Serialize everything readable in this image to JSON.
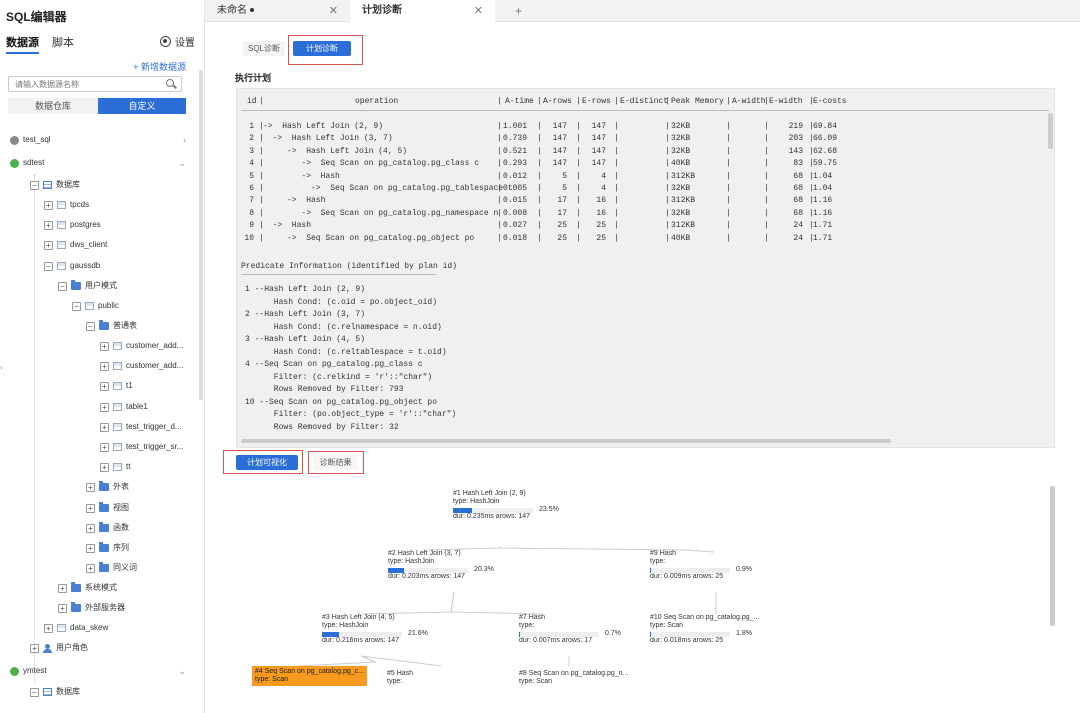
{
  "app_title": "SQL编辑器",
  "sidebar": {
    "tabs": [
      "数据源",
      "脚本"
    ],
    "settings_label": "设置",
    "add_datasource": "+ 新增数据源",
    "search_placeholder": "请输入数据源名称",
    "segments": [
      "数据仓库",
      "自定义"
    ],
    "tree": [
      {
        "label": "test_sql",
        "icon": "database-gray-icon"
      },
      {
        "label": "sdtest",
        "icon": "database-icon"
      },
      {
        "label": "数据库"
      },
      {
        "label": "tpcds"
      },
      {
        "label": "postgres"
      },
      {
        "label": "dws_client"
      },
      {
        "label": "gaussdb"
      },
      {
        "label": "用户模式"
      },
      {
        "label": "public"
      },
      {
        "label": "普通表"
      },
      {
        "label": "customer_add..."
      },
      {
        "label": "customer_add..."
      },
      {
        "label": "t1"
      },
      {
        "label": "table1"
      },
      {
        "label": "test_trigger_d..."
      },
      {
        "label": "test_trigger_sr..."
      },
      {
        "label": "tt"
      },
      {
        "label": "外表"
      },
      {
        "label": "视图"
      },
      {
        "label": "函数"
      },
      {
        "label": "序列"
      },
      {
        "label": "同义词"
      },
      {
        "label": "系统模式"
      },
      {
        "label": "外部服务器"
      },
      {
        "label": "data_skew"
      },
      {
        "label": "用户角色"
      },
      {
        "label": "ymtest",
        "icon": "database-icon"
      },
      {
        "label": "数据库"
      }
    ]
  },
  "tabs": [
    {
      "label": "未命名",
      "modified": true
    },
    {
      "label": "计划诊断",
      "active": true
    }
  ],
  "subtabs": [
    "SQL诊断",
    "计划诊断"
  ],
  "plan_title": "执行计划",
  "plan": {
    "headers": [
      "id",
      "operation",
      "A-time",
      "A-rows",
      "E-rows",
      "E-distinct",
      "Peak Memory",
      "A-width",
      "E-width",
      "E-costs"
    ],
    "rows": [
      {
        "id": "1",
        "op": "->  Hash Left Join (2, 9)",
        "atime": "1.001",
        "arows": "147",
        "erows": "147",
        "edist": "",
        "mem": "32KB",
        "awidth": "",
        "ewidth": "219",
        "ecost": "69.84"
      },
      {
        "id": "2",
        "op": "  ->  Hash Left Join (3, 7)",
        "atime": "0.739",
        "arows": "147",
        "erows": "147",
        "edist": "",
        "mem": "32KB",
        "awidth": "",
        "ewidth": "203",
        "ecost": "66.09"
      },
      {
        "id": "3",
        "op": "     ->  Hash Left Join (4, 5)",
        "atime": "0.521",
        "arows": "147",
        "erows": "147",
        "edist": "",
        "mem": "32KB",
        "awidth": "",
        "ewidth": "143",
        "ecost": "62.68"
      },
      {
        "id": "4",
        "op": "        ->  Seq Scan on pg_catalog.pg_class c",
        "atime": "0.293",
        "arows": "147",
        "erows": "147",
        "edist": "",
        "mem": "40KB",
        "awidth": "",
        "ewidth": "83",
        "ecost": "59.75"
      },
      {
        "id": "5",
        "op": "        ->  Hash",
        "atime": "0.012",
        "arows": "5",
        "erows": "4",
        "edist": "",
        "mem": "312KB",
        "awidth": "",
        "ewidth": "68",
        "ecost": "1.04"
      },
      {
        "id": "6",
        "op": "          ->  Seq Scan on pg_catalog.pg_tablespace t",
        "atime": "0.005",
        "arows": "5",
        "erows": "4",
        "edist": "",
        "mem": "32KB",
        "awidth": "",
        "ewidth": "68",
        "ecost": "1.04"
      },
      {
        "id": "7",
        "op": "     ->  Hash",
        "atime": "0.015",
        "arows": "17",
        "erows": "16",
        "edist": "",
        "mem": "312KB",
        "awidth": "",
        "ewidth": "68",
        "ecost": "1.16"
      },
      {
        "id": "8",
        "op": "        ->  Seq Scan on pg_catalog.pg_namespace n",
        "atime": "0.008",
        "arows": "17",
        "erows": "16",
        "edist": "",
        "mem": "32KB",
        "awidth": "",
        "ewidth": "68",
        "ecost": "1.16"
      },
      {
        "id": "9",
        "op": "  ->  Hash",
        "atime": "0.027",
        "arows": "25",
        "erows": "25",
        "edist": "",
        "mem": "312KB",
        "awidth": "",
        "ewidth": "24",
        "ecost": "1.71"
      },
      {
        "id": "10",
        "op": "     ->  Seq Scan on pg_catalog.pg_object po",
        "atime": "0.018",
        "arows": "25",
        "erows": "25",
        "edist": "",
        "mem": "40KB",
        "awidth": "",
        "ewidth": "24",
        "ecost": "1.71"
      }
    ],
    "predicate_title": "Predicate Information (identified by plan id)",
    "predicates": [
      "1 --Hash Left Join (2, 9)",
      "      Hash Cond: (c.oid = po.object_oid)",
      "2 --Hash Left Join (3, 7)",
      "      Hash Cond: (c.relnamespace = n.oid)",
      "3 --Hash Left Join (4, 5)",
      "      Hash Cond: (c.reltablespace = t.oid)",
      "4 --Seq Scan on pg_catalog.pg_class c",
      "      Filter: (c.relkind = 'r'::\"char\")",
      "      Rows Removed by Filter: 793",
      "10 --Seq Scan on pg_catalog.pg_object po",
      "      Filter: (po.object_type = 'r'::\"char\")",
      "      Rows Removed by Filter: 32"
    ]
  },
  "buttons": {
    "visualize": "计划可视化",
    "result": "诊断结果"
  },
  "plan_tree": [
    {
      "title": "#1 Hash Left Join (2, 9)",
      "type": "type: HashJoin",
      "dur": "dur: 0.235ms arows: 147",
      "pct_label": "23.5%",
      "pct": 23.5
    },
    {
      "title": "#2 Hash Left Join (3, 7)",
      "type": "type: HashJoin",
      "dur": "dur: 0.203ms arows: 147",
      "pct_label": "20.3%",
      "pct": 20.3
    },
    {
      "title": "#9 Hash",
      "type": "type:",
      "dur": "dur: 0.009ms arows: 25",
      "pct_label": "0.9%",
      "pct": 0.9
    },
    {
      "title": "#3 Hash Left Join (4, 5)",
      "type": "type: HashJoin",
      "dur": "dur: 0.216ms arows: 147",
      "pct_label": "21.6%",
      "pct": 21.6
    },
    {
      "title": "#7 Hash",
      "type": "type:",
      "dur": "dur: 0.007ms arows: 17",
      "pct_label": "0.7%",
      "pct": 0.7
    },
    {
      "title": "#10 Seq Scan on pg_catalog.pg_...",
      "type": "type: Scan",
      "dur": "dur: 0.018ms arows: 25",
      "pct_label": "1.8%",
      "pct": 1.8
    },
    {
      "title": "#4 Seq Scan on pg_catalog.pg_c...",
      "type": "type: Scan",
      "hot": true
    },
    {
      "title": "#5 Hash",
      "type": "type:"
    },
    {
      "title": "#8 Seq Scan on pg_catalog.pg_n...",
      "type": "type: Scan"
    }
  ],
  "colors": {
    "accent": "#2b6ed8",
    "hot_node": "#f79a1e",
    "highlight": "#d9534f"
  }
}
